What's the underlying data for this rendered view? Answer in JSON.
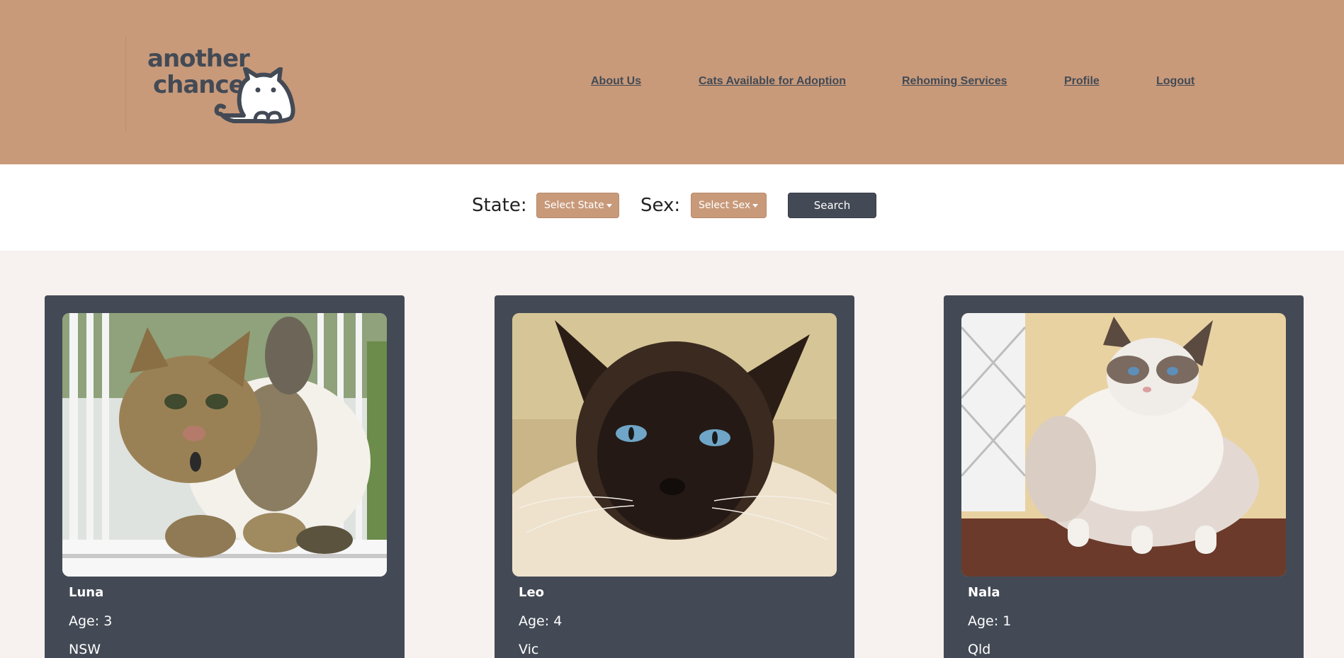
{
  "brand": {
    "logo_text_line1": "another",
    "logo_text_line2": "chance"
  },
  "nav": {
    "items": [
      {
        "label": "About Us"
      },
      {
        "label": "Cats Available for Adoption"
      },
      {
        "label": "Rehoming Services"
      },
      {
        "label": "Profile"
      },
      {
        "label": "Logout"
      }
    ]
  },
  "filters": {
    "state_label": "State:",
    "state_dropdown": "Select State",
    "sex_label": "Sex:",
    "sex_dropdown": "Select Sex",
    "search_button": "Search"
  },
  "cats": [
    {
      "name": "Luna",
      "age": "Age: 3",
      "state": "NSW",
      "photo_icon": "tabby-cat-photo"
    },
    {
      "name": "Leo",
      "age": "Age: 4",
      "state": "Vic",
      "photo_icon": "siamese-cat-photo"
    },
    {
      "name": "Nala",
      "age": "Age: 1",
      "state": "Qld",
      "photo_icon": "ragdoll-cat-photo"
    }
  ],
  "colors": {
    "header_bg": "#c89a7a",
    "dark": "#434a55",
    "page_bg": "#f7f1ef"
  }
}
